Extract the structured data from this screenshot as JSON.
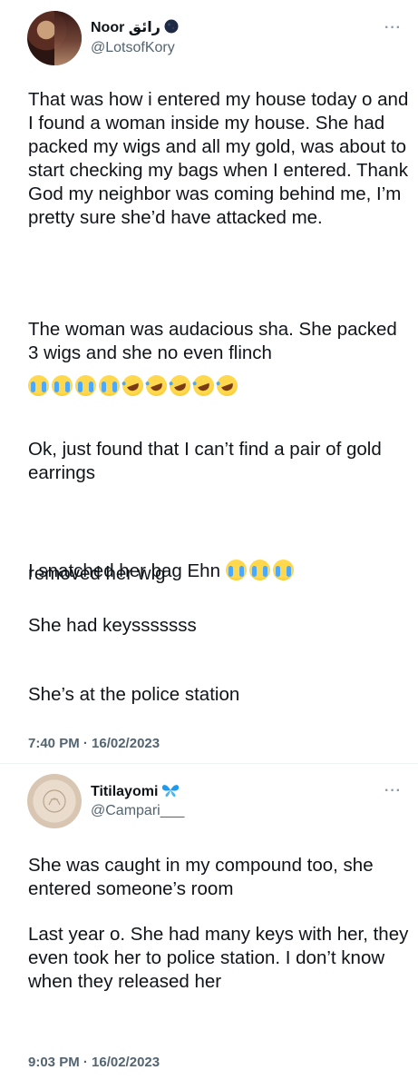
{
  "tweet1": {
    "name": "Noor رائق",
    "handle": "@LotsofKory",
    "more_label": "···",
    "paragraphs": [
      "That was how i entered my house today o and I found a woman inside my house. She had packed my wigs and all my gold, was about to start checking my bags when I entered. Thank God my neighbor was coming behind me, I’m pretty sure she’d have attacked me.",
      "The woman was audacious sha. She packed 3 wigs and she no even flinch",
      "Ok, just found that I can’t find a pair of gold earrings",
      "I snatched her bag Ehn",
      "removed her wig",
      "She had keysssssss",
      "She’s at the police station"
    ],
    "emoji_row": [
      "loudly-crying-face",
      "loudly-crying-face",
      "loudly-crying-face",
      "loudly-crying-face",
      "rolling-on-floor-laughing",
      "rolling-on-floor-laughing",
      "rolling-on-floor-laughing",
      "rolling-on-floor-laughing",
      "rolling-on-floor-laughing"
    ],
    "inline_emoji": [
      "loudly-crying-face",
      "loudly-crying-face",
      "loudly-crying-face"
    ],
    "timestamp": "7:40 PM · 16/02/2023"
  },
  "tweet2": {
    "name": "Titilayomi",
    "handle": "@Campari___",
    "more_label": "···",
    "paragraphs": [
      "She was caught in my compound too, she entered someone’s room",
      "Last year o. She had many keys with her, they even took her to police station. I don’t know when they released her"
    ],
    "timestamp": "9:03 PM · 16/02/2023"
  },
  "colors": {
    "text": "#0f1419",
    "secondary": "#536471",
    "badge_blue": "#1d9bf0"
  }
}
